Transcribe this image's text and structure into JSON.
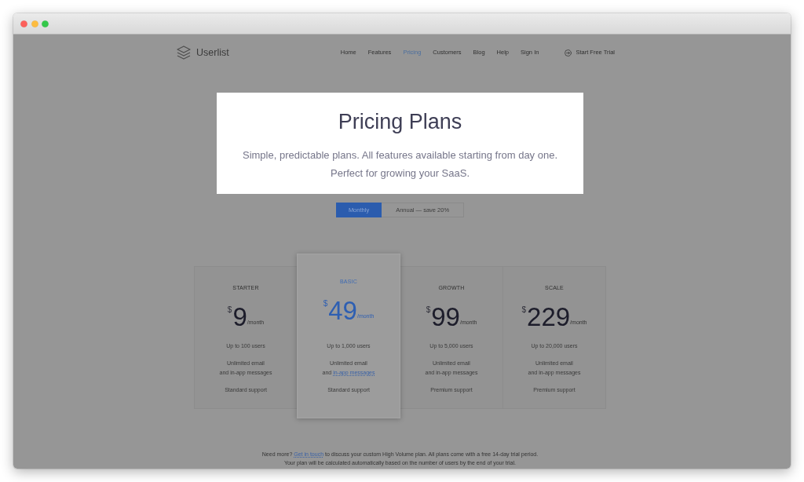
{
  "nav": {
    "brand": "Userlist",
    "links": [
      {
        "label": "Home",
        "selected": false
      },
      {
        "label": "Features",
        "selected": false
      },
      {
        "label": "Pricing",
        "selected": true
      },
      {
        "label": "Customers",
        "selected": false
      },
      {
        "label": "Blog",
        "selected": false
      },
      {
        "label": "Help",
        "selected": false
      },
      {
        "label": "Sign In",
        "selected": false
      }
    ],
    "cta": "Start Free Trial"
  },
  "hero": {
    "title": "Pricing Plans",
    "subtitle": [
      "Simple, predictable plans. All features available starting from day one.",
      "Perfect for growing your SaaS."
    ]
  },
  "billing_toggle": [
    {
      "label": "Monthly",
      "selected": true
    },
    {
      "label": "Annual — save 20%",
      "selected": false
    }
  ],
  "plans": [
    {
      "name": "STARTER",
      "highlighted": false,
      "currency": "$",
      "price": "9",
      "period": "/month",
      "features": [
        {
          "lines": [
            "Up to 100 users"
          ]
        },
        {
          "lines": [
            "Unlimited email",
            "and in-app messages"
          ]
        },
        {
          "lines": [
            "Standard support"
          ]
        }
      ]
    },
    {
      "name": "BASIC",
      "highlighted": true,
      "currency": "$",
      "price": "49",
      "period": "/month",
      "features": [
        {
          "lines": [
            "Up to 1,000 users"
          ]
        },
        {
          "lines": [
            "Unlimited email",
            "and"
          ],
          "link": "in-app messages"
        },
        {
          "lines": [
            "Standard support"
          ]
        }
      ]
    },
    {
      "name": "GROWTH",
      "highlighted": false,
      "currency": "$",
      "price": "99",
      "period": "/month",
      "features": [
        {
          "lines": [
            "Up to 5,000 users"
          ]
        },
        {
          "lines": [
            "Unlimited email",
            "and in-app messages"
          ]
        },
        {
          "lines": [
            "Premium support"
          ]
        }
      ]
    },
    {
      "name": "SCALE",
      "highlighted": false,
      "currency": "$",
      "price": "229",
      "period": "/month",
      "features": [
        {
          "lines": [
            "Up to 20,000 users"
          ]
        },
        {
          "lines": [
            "Unlimited email",
            "and in-app messages"
          ]
        },
        {
          "lines": [
            "Premium support"
          ]
        }
      ]
    }
  ],
  "footer": {
    "before_link": "Need more?",
    "link": "Get in touch",
    "after_link": "to discuss your custom High Volume plan. All plans come with a free 14-day trial period.",
    "second_line": "Your plan will be calculated automatically based on the number of users by the end of your trial."
  }
}
